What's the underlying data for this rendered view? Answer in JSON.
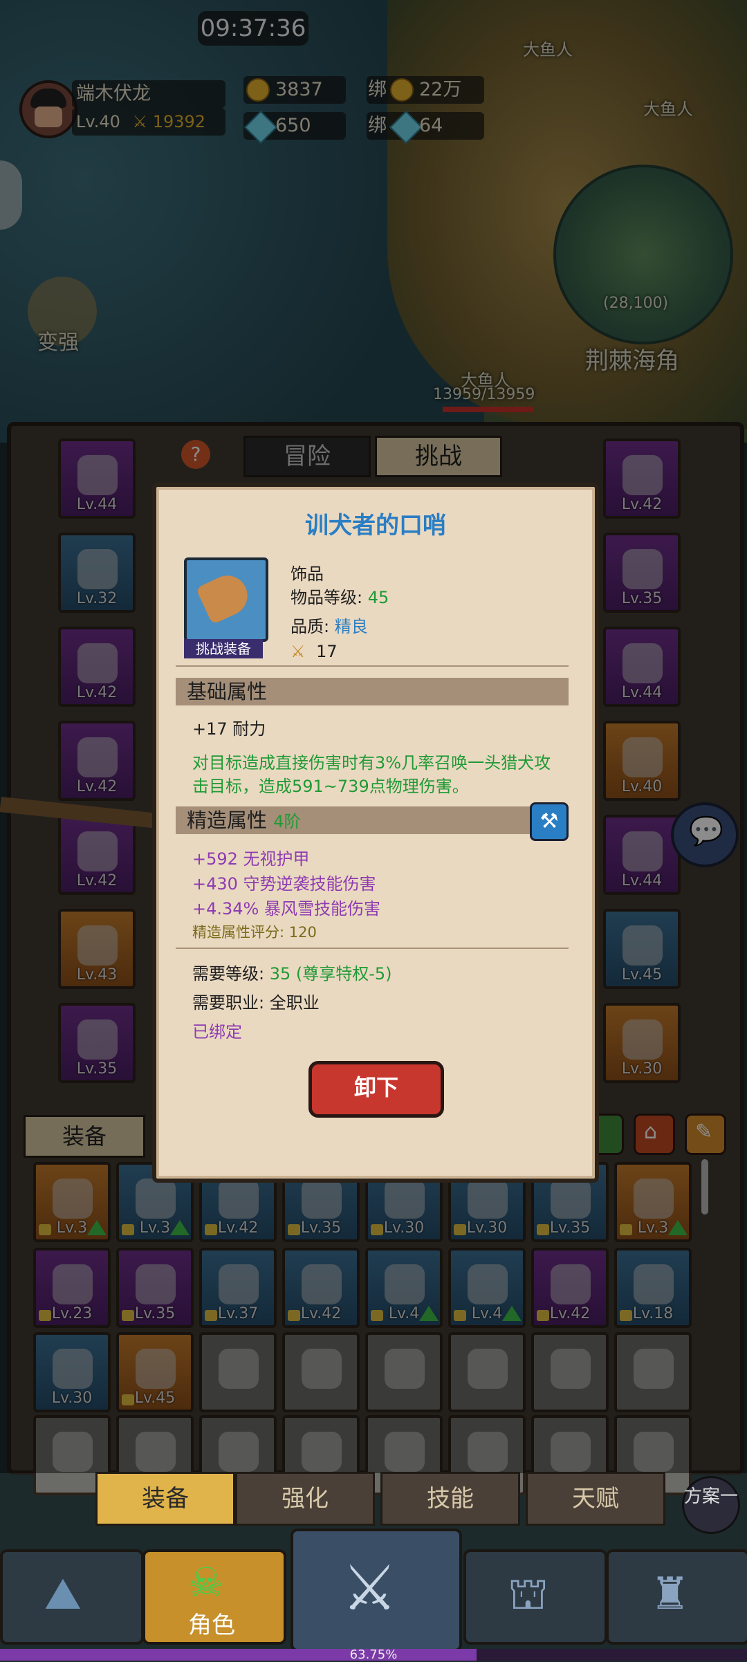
{
  "status": {
    "clock": "09:37:36"
  },
  "player": {
    "name": "端木伏龙",
    "level": "Lv.40",
    "power": "19392",
    "gold": "3837",
    "gems": "650",
    "bound_label": "绑",
    "bound_gold": "22万",
    "bound_gems": "64"
  },
  "map": {
    "enemy_1": "大鱼人",
    "enemy_2": "大鱼人",
    "enemy_3": "大鱼人",
    "enemy_hp": "13959/13959",
    "coords": "(28,100)",
    "zone": "荆棘海角",
    "strengthen": "变强"
  },
  "tabs": {
    "adventure": "冒险",
    "challenge": "挑战",
    "help": "?"
  },
  "left_slots": [
    {
      "level": "Lv.44",
      "color": "purple"
    },
    {
      "level": "Lv.32",
      "color": "blue"
    },
    {
      "level": "Lv.42",
      "color": "purple"
    },
    {
      "level": "Lv.42",
      "color": "purple"
    },
    {
      "level": "Lv.42",
      "color": "purple"
    },
    {
      "level": "Lv.43",
      "color": "orange"
    },
    {
      "level": "Lv.35",
      "color": "purple"
    }
  ],
  "right_slots": [
    {
      "level": "Lv.42",
      "color": "purple"
    },
    {
      "level": "Lv.35",
      "color": "purple"
    },
    {
      "level": "Lv.44",
      "color": "purple"
    },
    {
      "level": "Lv.40",
      "color": "orange"
    },
    {
      "level": "Lv.44",
      "color": "purple"
    },
    {
      "level": "Lv.45",
      "color": "blue"
    },
    {
      "level": "Lv.30",
      "color": "orange"
    }
  ],
  "inventory": {
    "header": "装备",
    "row1": [
      "Lv.3",
      "Lv.3",
      "Lv.42",
      "Lv.35",
      "Lv.30",
      "Lv.30",
      "Lv.35",
      "Lv.3"
    ],
    "row2": [
      "Lv.23",
      "Lv.35",
      "Lv.37",
      "Lv.42",
      "Lv.4",
      "Lv.4",
      "Lv.42",
      "Lv.18"
    ],
    "row3": [
      "Lv.30",
      "Lv.45"
    ]
  },
  "item": {
    "name": "训犬者的口哨",
    "category": "饰品",
    "item_level_label": "物品等级: ",
    "item_level": "45",
    "quality_label": "品质: ",
    "quality": "精良",
    "score": "17",
    "badge": "挑战装备",
    "base_title": "基础属性",
    "base_stat": "+17 耐力",
    "effect": "对目标造成直接伤害时有3%几率召唤一头猎犬攻击目标，造成591~739点物理伤害。",
    "refine_title": "精造属性",
    "refine_tier": "4阶",
    "refine_stats": [
      "+592 无视护甲",
      "+430 守势逆袭技能伤害",
      "+4.34% 暴风雪技能伤害"
    ],
    "refine_score": "精造属性评分: 120",
    "req_level_label": "需要等级: ",
    "req_level": "35 (尊享特权-5)",
    "req_class": "需要职业: 全职业",
    "bound": "已绑定",
    "unequip": "卸下"
  },
  "subtabs": [
    "装备",
    "强化",
    "技能",
    "天赋"
  ],
  "scheme": "方案一",
  "nav": {
    "role": "角色"
  },
  "xp": {
    "text": "63.75%",
    "percent": 63.75
  }
}
